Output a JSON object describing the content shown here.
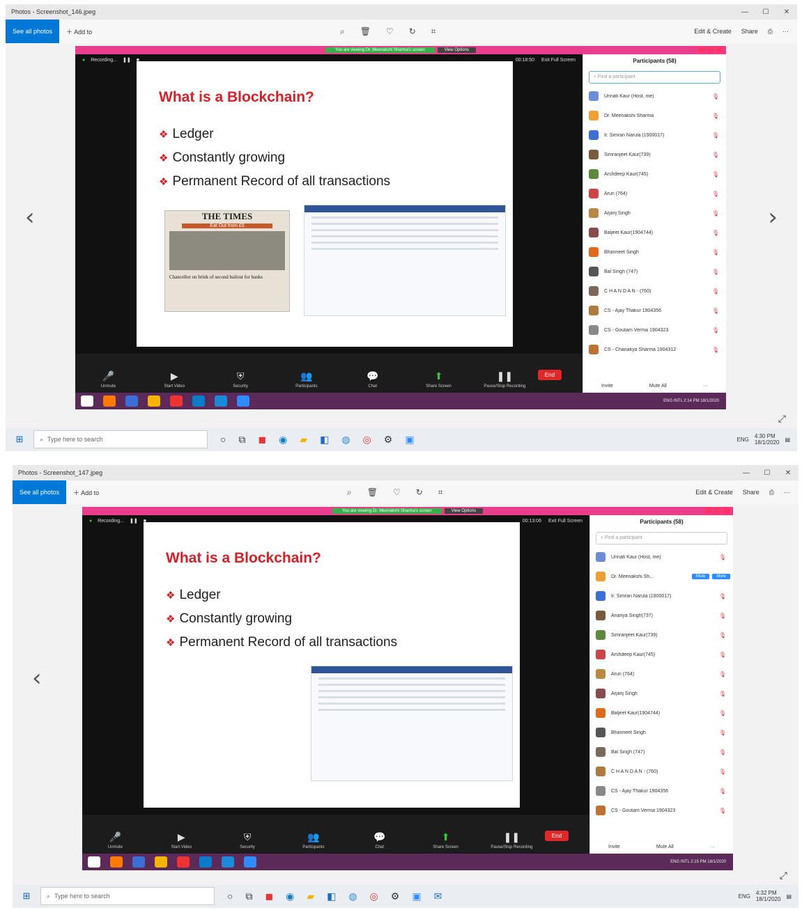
{
  "photos_app": {
    "screenshot1_title": "Photos - Screenshot_146.jpeg",
    "screenshot2_title": "Photos - Screenshot_147.jpeg",
    "see_all_photos": "See all photos",
    "add_to": "Add to",
    "edit_create": "Edit & Create",
    "share": "Share",
    "min": "—",
    "max": "☐",
    "close": "✕"
  },
  "zoom": {
    "viewing_banner": "You are viewing Dr. Meenakshi Sharma's screen",
    "view_options": "View Options",
    "recording": "Recording...",
    "exit_full_screen": "Exit Full Screen",
    "timer1": "00:18:50",
    "timer2": "00:13:06",
    "participants_title": "Participants (58)",
    "find_participant": "Find a participant",
    "toolbar": {
      "unmute": "Unmute",
      "start_video": "Start Video",
      "security": "Security",
      "participants": "Participants",
      "chat": "Chat",
      "share_screen": "Share Screen",
      "pause_recording": "Pause/Stop Recording",
      "end": "End"
    },
    "invite": "Invite",
    "mute_all": "Mute All",
    "mute_btn": "Mute",
    "more_btn": "More"
  },
  "slide": {
    "title": "What is a Blockchain?",
    "bullets": [
      "Ledger",
      "Constantly growing",
      "Permanent Record of all transactions"
    ],
    "news_masthead": "THE TIMES",
    "news_banner": "Eat Out from £5",
    "news_headline": "Chancellor on brink of second bailout for banks"
  },
  "participants1": [
    "Unnati Kaur (Host, me)",
    "Dr. Meenakshi Sharma",
    "Ir. Simran Narula (1900017)",
    "Simranjeet Kaur(739)",
    "Arshdeep Kaur(745)",
    "Arun (764)",
    "Arjanj Singh",
    "Baljeet Kaur(1904744)",
    "Bhanneet Singh",
    "Bal Singh (747)",
    "C H A N D A N - (760)",
    "CS - Ajay Thakur 1904356",
    "CS - Goutam Verma 1904323",
    "CS - Chanakya Sharma 1904312"
  ],
  "participants2": [
    "Unnati Kaur (Host, me)",
    "Dr. Meenakshi Sh...",
    "Ir. Simran Narula (1900017)",
    "Ananya Singh(737)",
    "Simranjeet Kaur(739)",
    "Arshdeep Kaur(745)",
    "Arun (764)",
    "Arjanj Singh",
    "Baljeet Kaur(1904744)",
    "Bhanneet Singh",
    "Bal Singh (747)",
    "C H A N D A N - (760)",
    "CS - Ajay Thakur 1904356",
    "CS - Goutam Verma 1904323"
  ],
  "taskbar": {
    "search_placeholder": "Type here to search",
    "lang": "ENG",
    "time1": "4:30 PM",
    "date1": "18/1/2020",
    "time2": "4:32 PM",
    "date2": "18/1/2020",
    "inner_lang": "ENG INTL",
    "inner_time1": "2:14 PM",
    "inner_time2": "2:15 PM",
    "inner_date": "18/1/2020"
  }
}
